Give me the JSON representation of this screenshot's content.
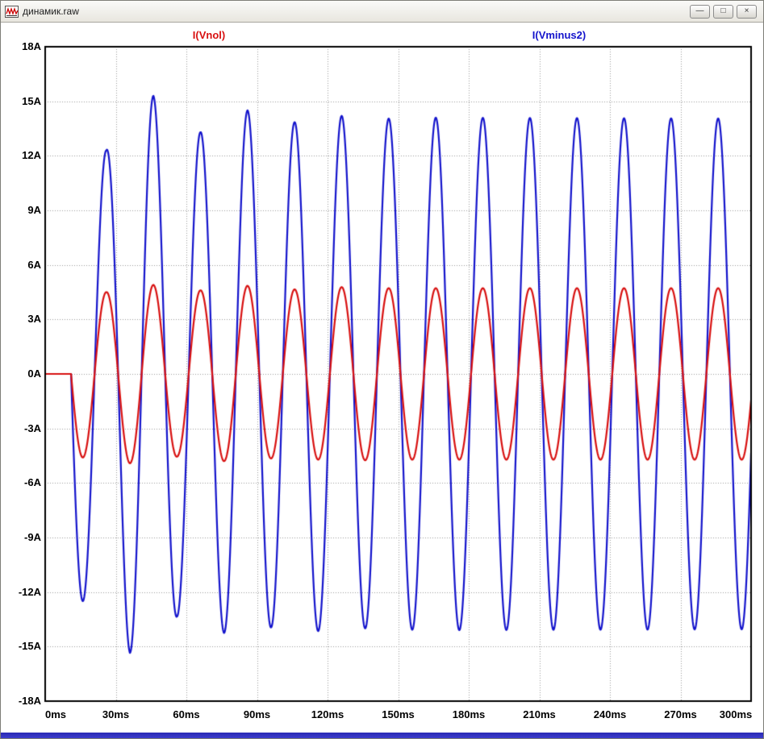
{
  "window": {
    "title": "динамик.raw",
    "buttons": {
      "minimize_glyph": "—",
      "restore_glyph": "□",
      "close_glyph": "×"
    }
  },
  "chart_data": {
    "type": "line",
    "title": "",
    "grid": "dotted",
    "grid_color": "#9a9a9a",
    "frame_color": "#000000",
    "background_color": "#ffffff",
    "x_axis": {
      "unit": "ms",
      "min": 0,
      "max": 300,
      "tick_step": 30,
      "ticks": [
        {
          "value": 0,
          "label": "0ms"
        },
        {
          "value": 30,
          "label": "30ms"
        },
        {
          "value": 60,
          "label": "60ms"
        },
        {
          "value": 90,
          "label": "90ms"
        },
        {
          "value": 120,
          "label": "120ms"
        },
        {
          "value": 150,
          "label": "150ms"
        },
        {
          "value": 180,
          "label": "180ms"
        },
        {
          "value": 210,
          "label": "210ms"
        },
        {
          "value": 240,
          "label": "240ms"
        },
        {
          "value": 270,
          "label": "270ms"
        },
        {
          "value": 300,
          "label": "300ms"
        }
      ]
    },
    "y_axis": {
      "unit": "A",
      "min": -18,
      "max": 18,
      "tick_step": 3,
      "ticks": [
        {
          "value": 18,
          "label": "18A"
        },
        {
          "value": 15,
          "label": "15A"
        },
        {
          "value": 12,
          "label": "12A"
        },
        {
          "value": 9,
          "label": "9A"
        },
        {
          "value": 6,
          "label": "6A"
        },
        {
          "value": 3,
          "label": "3A"
        },
        {
          "value": 0,
          "label": "0A"
        },
        {
          "value": -3,
          "label": "-3A"
        },
        {
          "value": -6,
          "label": "-6A"
        },
        {
          "value": -9,
          "label": "-9A"
        },
        {
          "value": -12,
          "label": "-12A"
        },
        {
          "value": -15,
          "label": "-15A"
        },
        {
          "value": -18,
          "label": "-18A"
        }
      ]
    },
    "series": [
      {
        "name": "I(Vnol)",
        "color": "#d81010",
        "waveform": "sine",
        "start_ms": 11,
        "period_ms": 20,
        "first_halfcycle": "negative",
        "steady_amplitude_A": 4.72,
        "envelope_points": [
          [
            16,
            4.6
          ],
          [
            26,
            4.5
          ],
          [
            36,
            4.92
          ],
          [
            46,
            4.9
          ],
          [
            56,
            4.55
          ],
          [
            66,
            4.6
          ],
          [
            76,
            4.8
          ],
          [
            86,
            4.85
          ],
          [
            96,
            4.65
          ],
          [
            106,
            4.65
          ],
          [
            126,
            4.78
          ],
          [
            146,
            4.72
          ],
          [
            300,
            4.72
          ]
        ]
      },
      {
        "name": "I(Vminus2)",
        "color": "#1414cc",
        "waveform": "sine",
        "start_ms": 11,
        "period_ms": 20,
        "first_halfcycle": "negative",
        "steady_amplitude_A": 14.05,
        "envelope_points": [
          [
            16,
            12.5
          ],
          [
            26,
            12.3
          ],
          [
            36,
            15.35
          ],
          [
            46,
            15.3
          ],
          [
            56,
            13.35
          ],
          [
            66,
            13.3
          ],
          [
            76,
            14.25
          ],
          [
            86,
            14.5
          ],
          [
            96,
            13.95
          ],
          [
            106,
            13.85
          ],
          [
            116,
            14.15
          ],
          [
            126,
            14.2
          ],
          [
            136,
            14.0
          ],
          [
            146,
            14.05
          ],
          [
            166,
            14.1
          ],
          [
            300,
            14.05
          ]
        ]
      }
    ]
  }
}
